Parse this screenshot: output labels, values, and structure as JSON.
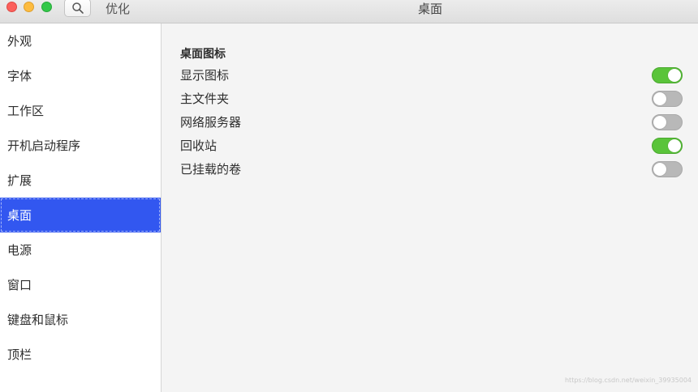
{
  "window": {
    "app_title": "优化",
    "panel_title": "桌面",
    "traffic_lights": {
      "close": "#fc605c",
      "minimize": "#fdbc40",
      "maximize": "#34c84a"
    }
  },
  "sidebar": {
    "items": [
      {
        "label": "外观",
        "active": false
      },
      {
        "label": "字体",
        "active": false
      },
      {
        "label": "工作区",
        "active": false
      },
      {
        "label": "开机启动程序",
        "active": false
      },
      {
        "label": "扩展",
        "active": false
      },
      {
        "label": "桌面",
        "active": true
      },
      {
        "label": "电源",
        "active": false
      },
      {
        "label": "窗口",
        "active": false
      },
      {
        "label": "键盘和鼠标",
        "active": false
      },
      {
        "label": "顶栏",
        "active": false
      }
    ]
  },
  "content": {
    "section_heading": "桌面图标",
    "settings": [
      {
        "label": "显示图标",
        "enabled": true
      },
      {
        "label": "主文件夹",
        "enabled": false
      },
      {
        "label": "网络服务器",
        "enabled": false
      },
      {
        "label": "回收站",
        "enabled": true
      },
      {
        "label": "已挂载的卷",
        "enabled": false
      }
    ]
  },
  "colors": {
    "sidebar_active": "#3257f0",
    "toggle_on": "#5ac43a",
    "toggle_off": "#b8b8b8"
  },
  "watermark": "https://blog.csdn.net/weixin_39935004"
}
